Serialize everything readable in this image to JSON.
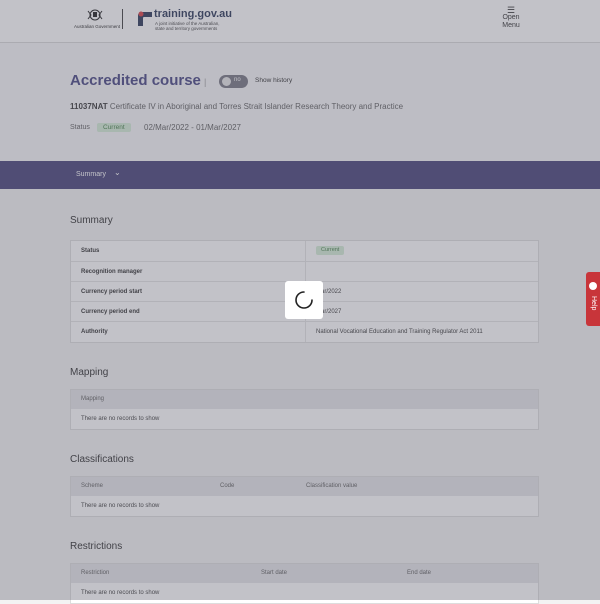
{
  "header": {
    "gov_name": "Australian Government",
    "site_name": "training.gov.au",
    "site_tagline": "A joint initiative of the Australian, state and territory governments",
    "menu_icon": "☰",
    "menu_label_1": "Open",
    "menu_label_2": "Menu"
  },
  "hero": {
    "title": "Accredited course",
    "separator": "|",
    "toggle_state": "no",
    "show_history_label": "Show history",
    "course_code": "11037NAT",
    "course_name": "Certificate IV in Aboriginal and Torres Strait Islander Research Theory and Practice",
    "status_label": "Status",
    "status_value": "Current",
    "date_start": "02/Mar/2022",
    "date_sep": "-",
    "date_end": "01/Mar/2027"
  },
  "nav": {
    "summary_label": "Summary",
    "chevron": "⌄"
  },
  "summary": {
    "title": "Summary",
    "rows": [
      {
        "label": "Status",
        "value": "Current",
        "pill": true
      },
      {
        "label": "Recognition manager",
        "value": ""
      },
      {
        "label": "Currency period start",
        "value": "Mar/2022"
      },
      {
        "label": "Currency period end",
        "value": "Mar/2027"
      },
      {
        "label": "Authority",
        "value": "National Vocational Education and Training Regulator Act 2011"
      }
    ]
  },
  "mapping": {
    "title": "Mapping",
    "headers": [
      "Mapping"
    ],
    "empty": "There are no records to show"
  },
  "classifications": {
    "title": "Classifications",
    "headers": [
      "Scheme",
      "Code",
      "Classification value"
    ],
    "empty": "There are no records to show"
  },
  "restrictions": {
    "title": "Restrictions",
    "headers": [
      "Restriction",
      "Start date",
      "End date"
    ],
    "empty": "There are no records to show"
  },
  "help": {
    "label": "Help"
  },
  "colors": {
    "accent": "#3b3670",
    "title": "#3b3a7a",
    "status_green_bg": "#d3ecd4",
    "help_red": "#c8353a"
  }
}
